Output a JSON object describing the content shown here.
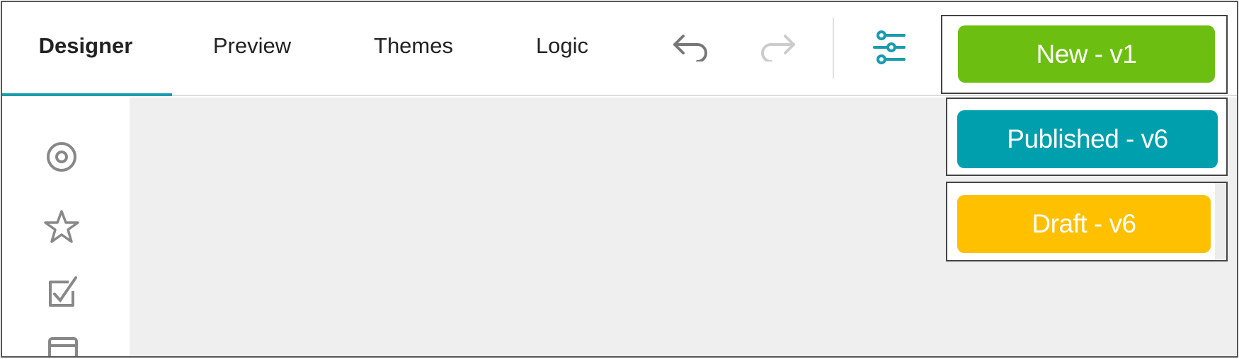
{
  "tabs": [
    {
      "label": "Designer",
      "active": true
    },
    {
      "label": "Preview"
    },
    {
      "label": "Themes"
    },
    {
      "label": "Logic"
    }
  ],
  "toolbar": {
    "icons": [
      "undo-icon",
      "redo-icon",
      "settings-sliders-icon"
    ]
  },
  "sidebar": {
    "icons": [
      "radio-button-icon",
      "star-icon",
      "checkbox-icon",
      "panel-icon"
    ]
  },
  "versions": [
    {
      "label": "New - v1",
      "color": "#6cbf10"
    },
    {
      "label": "Published - v6",
      "color": "#009fae"
    },
    {
      "label": "Draft - v6",
      "color": "#ffc000"
    }
  ],
  "colors": {
    "accent": "#1a9bb0",
    "canvas": "#efefef"
  }
}
